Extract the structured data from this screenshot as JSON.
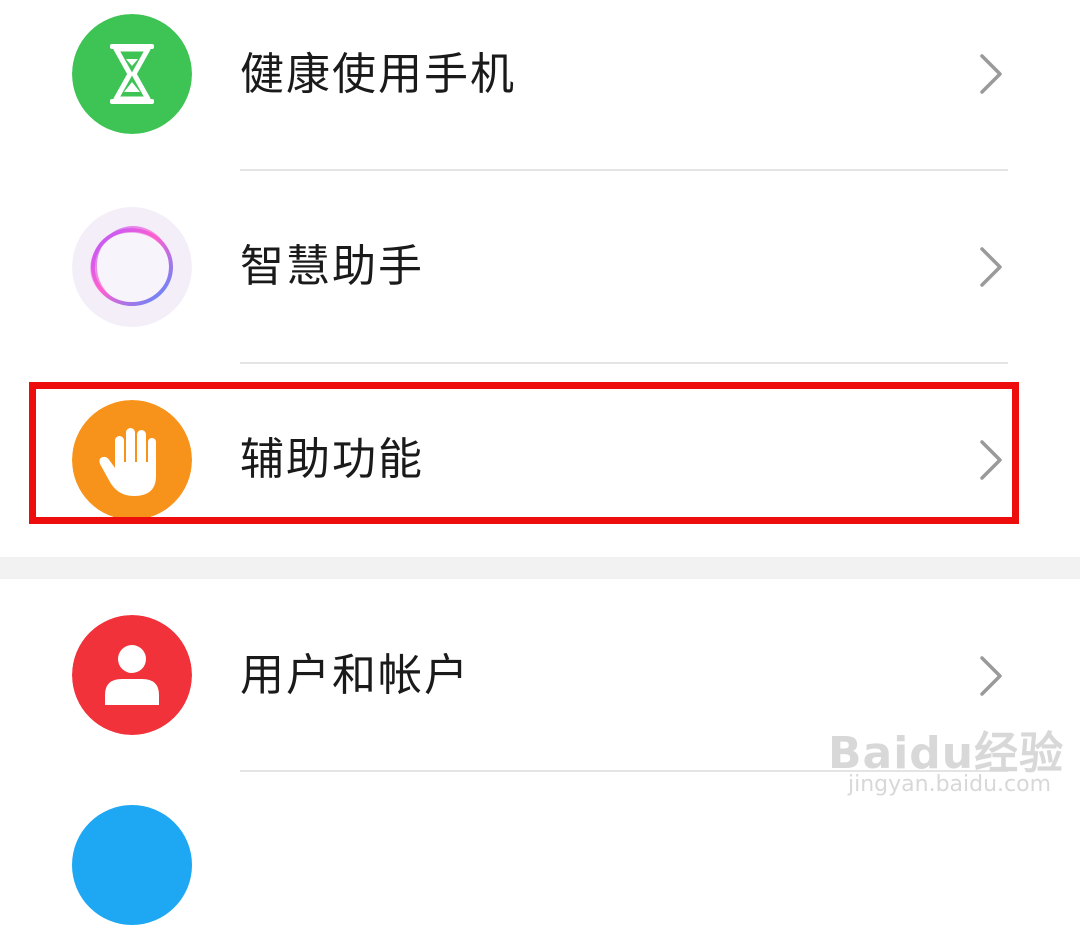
{
  "settings_items": [
    {
      "label": "健康使用手机",
      "icon": "hourglass-icon",
      "color": "#3ec454"
    },
    {
      "label": "智慧助手",
      "icon": "assistant-ring-icon",
      "color": "#f3eef8"
    },
    {
      "label": "辅助功能",
      "icon": "hand-icon",
      "color": "#f7931a"
    },
    {
      "label": "用户和帐户",
      "icon": "user-icon",
      "color": "#f1323a"
    }
  ],
  "highlight": {
    "color": "#ee0d0d",
    "target": "辅助功能"
  },
  "watermark": {
    "logo": "Baidu经验",
    "url": "jingyan.baidu.com"
  }
}
